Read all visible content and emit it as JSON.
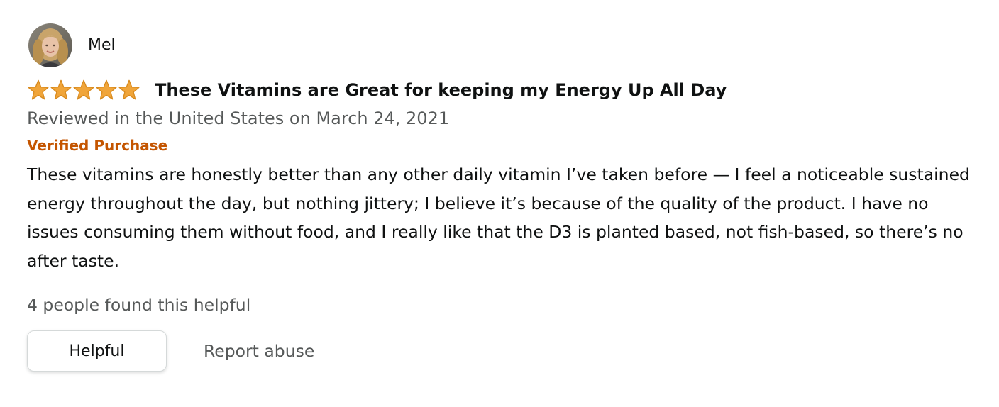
{
  "reviewer": {
    "name": "Mel",
    "avatar_icon": "user-avatar-photo"
  },
  "review": {
    "rating": 5,
    "rating_max": 5,
    "star_color": "#f0a53a",
    "title": "These Vitamins are Great for keeping my Energy Up All Day",
    "date_line": "Reviewed in the United States on March 24, 2021",
    "verified_label": "Verified Purchase",
    "verified_color": "#c45500",
    "body": "These vitamins are honestly better than any other daily vitamin I’ve taken before — I feel a noticeable sustained energy throughout the day, but nothing jittery; I believe it’s because of the quality of the product. I have no issues consuming them without food, and I really like that the D3 is planted based, not fish-based, so there’s no after taste.",
    "helpful_count_text": "4 people found this helpful"
  },
  "actions": {
    "helpful_label": "Helpful",
    "report_label": "Report abuse"
  }
}
